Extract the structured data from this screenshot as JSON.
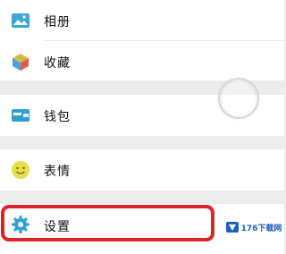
{
  "menu": {
    "group1": [
      {
        "label": "相册",
        "icon": "photo-album-icon"
      },
      {
        "label": "收藏",
        "icon": "favorites-cube-icon"
      }
    ],
    "group2": [
      {
        "label": "钱包",
        "icon": "wallet-icon"
      }
    ],
    "group3": [
      {
        "label": "表情",
        "icon": "emoji-icon"
      }
    ],
    "group4": [
      {
        "label": "设置",
        "icon": "settings-gear-icon"
      }
    ]
  },
  "watermark": {
    "text": "176下载网"
  },
  "colors": {
    "highlight": "#d6262a",
    "background": "#ececec",
    "accent_blue": "#3aa7d8"
  }
}
